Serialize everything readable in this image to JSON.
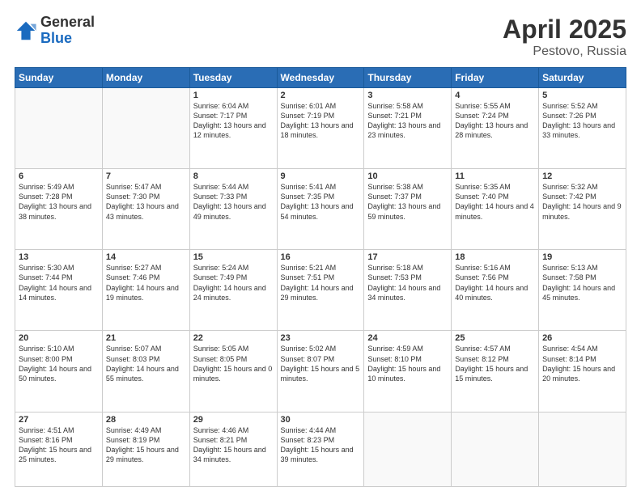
{
  "logo": {
    "general": "General",
    "blue": "Blue"
  },
  "title": {
    "month_year": "April 2025",
    "location": "Pestovo, Russia"
  },
  "weekdays": [
    "Sunday",
    "Monday",
    "Tuesday",
    "Wednesday",
    "Thursday",
    "Friday",
    "Saturday"
  ],
  "weeks": [
    [
      {
        "day": "",
        "info": ""
      },
      {
        "day": "",
        "info": ""
      },
      {
        "day": "1",
        "info": "Sunrise: 6:04 AM\nSunset: 7:17 PM\nDaylight: 13 hours and 12 minutes."
      },
      {
        "day": "2",
        "info": "Sunrise: 6:01 AM\nSunset: 7:19 PM\nDaylight: 13 hours and 18 minutes."
      },
      {
        "day": "3",
        "info": "Sunrise: 5:58 AM\nSunset: 7:21 PM\nDaylight: 13 hours and 23 minutes."
      },
      {
        "day": "4",
        "info": "Sunrise: 5:55 AM\nSunset: 7:24 PM\nDaylight: 13 hours and 28 minutes."
      },
      {
        "day": "5",
        "info": "Sunrise: 5:52 AM\nSunset: 7:26 PM\nDaylight: 13 hours and 33 minutes."
      }
    ],
    [
      {
        "day": "6",
        "info": "Sunrise: 5:49 AM\nSunset: 7:28 PM\nDaylight: 13 hours and 38 minutes."
      },
      {
        "day": "7",
        "info": "Sunrise: 5:47 AM\nSunset: 7:30 PM\nDaylight: 13 hours and 43 minutes."
      },
      {
        "day": "8",
        "info": "Sunrise: 5:44 AM\nSunset: 7:33 PM\nDaylight: 13 hours and 49 minutes."
      },
      {
        "day": "9",
        "info": "Sunrise: 5:41 AM\nSunset: 7:35 PM\nDaylight: 13 hours and 54 minutes."
      },
      {
        "day": "10",
        "info": "Sunrise: 5:38 AM\nSunset: 7:37 PM\nDaylight: 13 hours and 59 minutes."
      },
      {
        "day": "11",
        "info": "Sunrise: 5:35 AM\nSunset: 7:40 PM\nDaylight: 14 hours and 4 minutes."
      },
      {
        "day": "12",
        "info": "Sunrise: 5:32 AM\nSunset: 7:42 PM\nDaylight: 14 hours and 9 minutes."
      }
    ],
    [
      {
        "day": "13",
        "info": "Sunrise: 5:30 AM\nSunset: 7:44 PM\nDaylight: 14 hours and 14 minutes."
      },
      {
        "day": "14",
        "info": "Sunrise: 5:27 AM\nSunset: 7:46 PM\nDaylight: 14 hours and 19 minutes."
      },
      {
        "day": "15",
        "info": "Sunrise: 5:24 AM\nSunset: 7:49 PM\nDaylight: 14 hours and 24 minutes."
      },
      {
        "day": "16",
        "info": "Sunrise: 5:21 AM\nSunset: 7:51 PM\nDaylight: 14 hours and 29 minutes."
      },
      {
        "day": "17",
        "info": "Sunrise: 5:18 AM\nSunset: 7:53 PM\nDaylight: 14 hours and 34 minutes."
      },
      {
        "day": "18",
        "info": "Sunrise: 5:16 AM\nSunset: 7:56 PM\nDaylight: 14 hours and 40 minutes."
      },
      {
        "day": "19",
        "info": "Sunrise: 5:13 AM\nSunset: 7:58 PM\nDaylight: 14 hours and 45 minutes."
      }
    ],
    [
      {
        "day": "20",
        "info": "Sunrise: 5:10 AM\nSunset: 8:00 PM\nDaylight: 14 hours and 50 minutes."
      },
      {
        "day": "21",
        "info": "Sunrise: 5:07 AM\nSunset: 8:03 PM\nDaylight: 14 hours and 55 minutes."
      },
      {
        "day": "22",
        "info": "Sunrise: 5:05 AM\nSunset: 8:05 PM\nDaylight: 15 hours and 0 minutes."
      },
      {
        "day": "23",
        "info": "Sunrise: 5:02 AM\nSunset: 8:07 PM\nDaylight: 15 hours and 5 minutes."
      },
      {
        "day": "24",
        "info": "Sunrise: 4:59 AM\nSunset: 8:10 PM\nDaylight: 15 hours and 10 minutes."
      },
      {
        "day": "25",
        "info": "Sunrise: 4:57 AM\nSunset: 8:12 PM\nDaylight: 15 hours and 15 minutes."
      },
      {
        "day": "26",
        "info": "Sunrise: 4:54 AM\nSunset: 8:14 PM\nDaylight: 15 hours and 20 minutes."
      }
    ],
    [
      {
        "day": "27",
        "info": "Sunrise: 4:51 AM\nSunset: 8:16 PM\nDaylight: 15 hours and 25 minutes."
      },
      {
        "day": "28",
        "info": "Sunrise: 4:49 AM\nSunset: 8:19 PM\nDaylight: 15 hours and 29 minutes."
      },
      {
        "day": "29",
        "info": "Sunrise: 4:46 AM\nSunset: 8:21 PM\nDaylight: 15 hours and 34 minutes."
      },
      {
        "day": "30",
        "info": "Sunrise: 4:44 AM\nSunset: 8:23 PM\nDaylight: 15 hours and 39 minutes."
      },
      {
        "day": "",
        "info": ""
      },
      {
        "day": "",
        "info": ""
      },
      {
        "day": "",
        "info": ""
      }
    ]
  ]
}
